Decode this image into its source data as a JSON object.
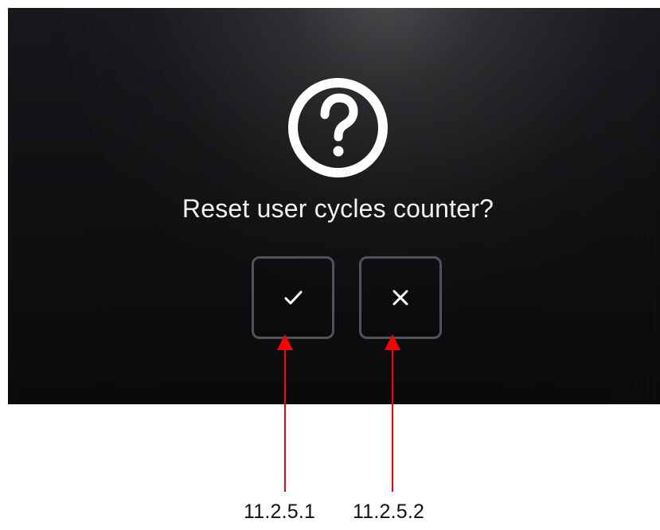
{
  "dialog": {
    "icon": "question-circle-icon",
    "title": "Reset user cycles counter?",
    "buttons": [
      {
        "name": "confirm",
        "icon": "checkmark-icon"
      },
      {
        "name": "cancel",
        "icon": "close-icon"
      }
    ]
  },
  "annotations": [
    {
      "label": "11.2.5.1",
      "target": "confirm-button"
    },
    {
      "label": "11.2.5.2",
      "target": "cancel-button"
    }
  ],
  "colors": {
    "background": "#0d0d10",
    "title_text": "#f2f2f2",
    "button_border": "#50545a",
    "icon": "#ffffff",
    "annotation_arrow": "#ff0000",
    "annotation_text": "#111111"
  }
}
